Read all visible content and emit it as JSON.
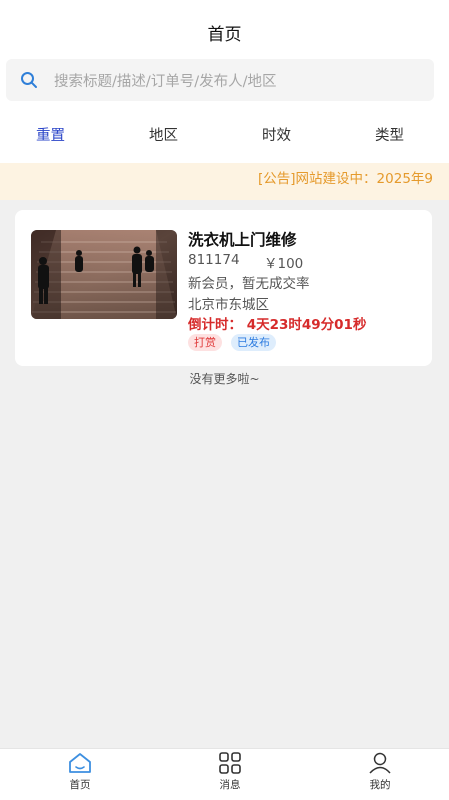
{
  "header": {
    "title": "首页"
  },
  "search": {
    "placeholder": "搜索标题/描述/订单号/发布人/地区"
  },
  "filters": [
    {
      "label": "重置",
      "active": true
    },
    {
      "label": "地区"
    },
    {
      "label": "时效"
    },
    {
      "label": "类型"
    }
  ],
  "notice": {
    "text": "[公告]网站建设中：2025年9"
  },
  "listing": {
    "title": "洗衣机上门维修",
    "order_no": "811174",
    "price": "￥100",
    "member_status": "新会员，暂无成交率",
    "location": "北京市东城区",
    "countdown": "倒计时： 4天23时49分01秒",
    "tags": [
      "打赏",
      "已发布"
    ]
  },
  "list_footer": "没有更多啦~",
  "tabbar": [
    {
      "label": "首页",
      "icon": "home-icon",
      "active": true
    },
    {
      "label": "消息",
      "icon": "grid-icon"
    },
    {
      "label": "我的",
      "icon": "user-icon"
    }
  ],
  "colors": {
    "accent": "#2a44c8",
    "notice_bg": "#fdf3e2",
    "notice_text": "#e59a2c",
    "countdown": "#d62b2b"
  }
}
